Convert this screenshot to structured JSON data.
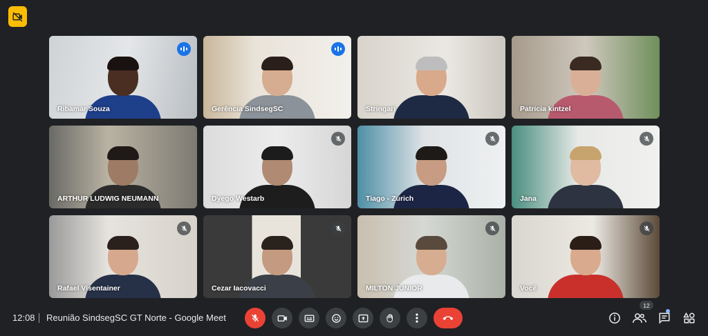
{
  "window": {
    "title": "Reunião SindsegSC GT Norte - Google Meet"
  },
  "colors": {
    "accent": "#8ab4f8",
    "speaking": "#1a73e8",
    "danger": "#ea4335",
    "badge": "#fbbc04"
  },
  "participants": [
    {
      "name": "Ribamar Souza",
      "status": "speaking",
      "active": true
    },
    {
      "name": "Gerência SindsegSC",
      "status": "speaking",
      "active": false
    },
    {
      "name": "Stringari",
      "status": "none",
      "active": false
    },
    {
      "name": "Patricia kintzel",
      "status": "none",
      "active": false
    },
    {
      "name": "ARTHUR LUDWIG NEUMANN",
      "status": "none",
      "active": false
    },
    {
      "name": "Dyego Westarb",
      "status": "muted",
      "active": false
    },
    {
      "name": "Tiago - Zurich",
      "status": "muted",
      "active": false
    },
    {
      "name": "Jana",
      "status": "muted",
      "active": false
    },
    {
      "name": "Rafael Visentainer",
      "status": "muted",
      "active": false
    },
    {
      "name": "Cezar Iacovacci",
      "status": "muted",
      "active": false
    },
    {
      "name": "MILTON JUNIOR",
      "status": "muted",
      "active": false
    },
    {
      "name": "Você",
      "status": "muted",
      "active": false
    }
  ],
  "bottom_bar": {
    "time": "12:08",
    "meeting_title": "Reunião SindsegSC GT Norte - Google Meet",
    "controls": [
      "mic-off-icon",
      "camera-icon",
      "captions-icon",
      "emoji-icon",
      "present-icon",
      "raise-hand-icon",
      "more-icon",
      "hang-up-icon"
    ],
    "right_icons": [
      "info-icon",
      "people-icon",
      "chat-icon",
      "activities-icon"
    ],
    "participant_count": "12"
  }
}
